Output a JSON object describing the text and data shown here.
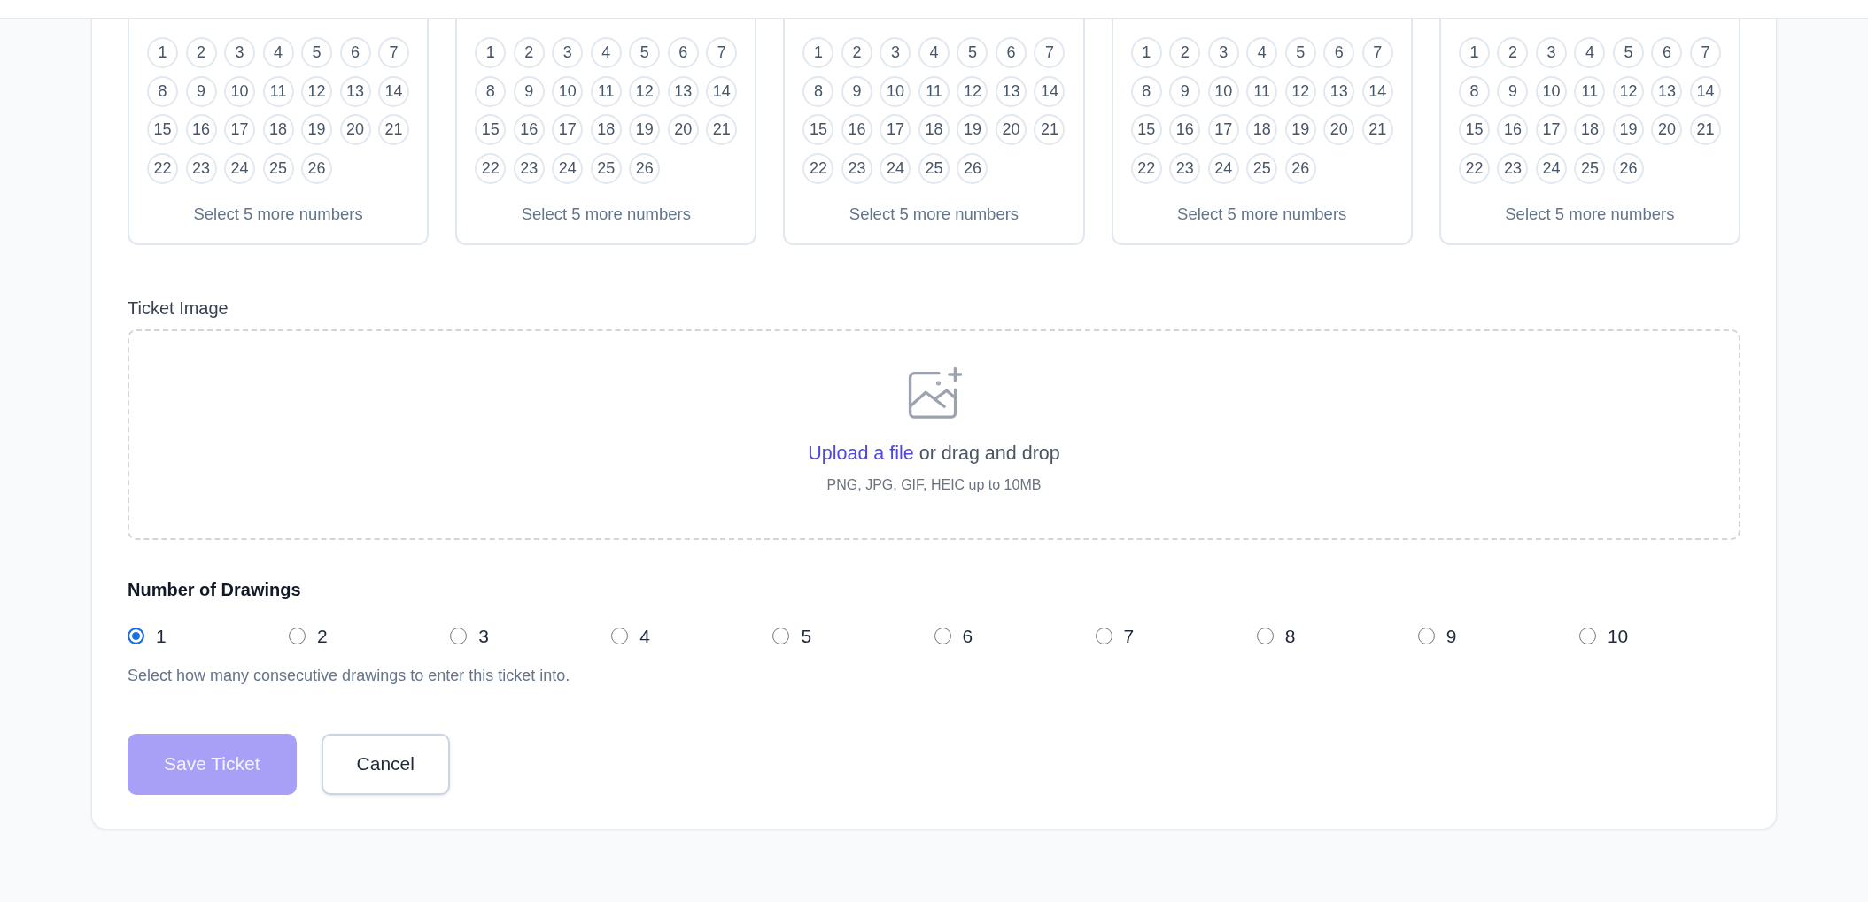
{
  "tickets": [
    {
      "numbers": [
        {
          "label": "1",
          "selected": false
        },
        {
          "label": "2",
          "selected": false
        },
        {
          "label": "3",
          "selected": false
        },
        {
          "label": "4",
          "selected": false
        },
        {
          "label": "5",
          "selected": false
        },
        {
          "label": "6",
          "selected": false
        },
        {
          "label": "7",
          "selected": false
        },
        {
          "label": "8",
          "selected": false
        },
        {
          "label": "9",
          "selected": false
        },
        {
          "label": "10",
          "selected": false
        },
        {
          "label": "11",
          "selected": false
        },
        {
          "label": "12",
          "selected": false
        },
        {
          "label": "13",
          "selected": false
        },
        {
          "label": "14",
          "selected": false
        },
        {
          "label": "15",
          "selected": false
        },
        {
          "label": "16",
          "selected": false
        },
        {
          "label": "17",
          "selected": false
        },
        {
          "label": "18",
          "selected": false
        },
        {
          "label": "19",
          "selected": false
        },
        {
          "label": "20",
          "selected": false
        },
        {
          "label": "21",
          "selected": false
        },
        {
          "label": "22",
          "selected": false
        },
        {
          "label": "23",
          "selected": false
        },
        {
          "label": "24",
          "selected": false
        },
        {
          "label": "25",
          "selected": false
        },
        {
          "label": "26",
          "selected": false
        }
      ],
      "hint": "Select 5 more numbers"
    },
    {
      "numbers": [
        {
          "label": "1",
          "selected": false
        },
        {
          "label": "2",
          "selected": false
        },
        {
          "label": "3",
          "selected": false
        },
        {
          "label": "4",
          "selected": false
        },
        {
          "label": "5",
          "selected": false
        },
        {
          "label": "6",
          "selected": false
        },
        {
          "label": "7",
          "selected": false
        },
        {
          "label": "8",
          "selected": false
        },
        {
          "label": "9",
          "selected": false
        },
        {
          "label": "10",
          "selected": false
        },
        {
          "label": "11",
          "selected": false
        },
        {
          "label": "12",
          "selected": false
        },
        {
          "label": "13",
          "selected": false
        },
        {
          "label": "14",
          "selected": false
        },
        {
          "label": "15",
          "selected": false
        },
        {
          "label": "16",
          "selected": false
        },
        {
          "label": "17",
          "selected": false
        },
        {
          "label": "18",
          "selected": false
        },
        {
          "label": "19",
          "selected": false
        },
        {
          "label": "20",
          "selected": false
        },
        {
          "label": "21",
          "selected": false
        },
        {
          "label": "22",
          "selected": false
        },
        {
          "label": "23",
          "selected": false
        },
        {
          "label": "24",
          "selected": false
        },
        {
          "label": "25",
          "selected": false
        },
        {
          "label": "26",
          "selected": false
        }
      ],
      "hint": "Select 5 more numbers"
    },
    {
      "numbers": [
        {
          "label": "1",
          "selected": false
        },
        {
          "label": "2",
          "selected": false
        },
        {
          "label": "3",
          "selected": false
        },
        {
          "label": "4",
          "selected": false
        },
        {
          "label": "5",
          "selected": false
        },
        {
          "label": "6",
          "selected": false
        },
        {
          "label": "7",
          "selected": false
        },
        {
          "label": "8",
          "selected": false
        },
        {
          "label": "9",
          "selected": false
        },
        {
          "label": "10",
          "selected": false
        },
        {
          "label": "11",
          "selected": false
        },
        {
          "label": "12",
          "selected": false
        },
        {
          "label": "13",
          "selected": false
        },
        {
          "label": "14",
          "selected": false
        },
        {
          "label": "15",
          "selected": false
        },
        {
          "label": "16",
          "selected": false
        },
        {
          "label": "17",
          "selected": false
        },
        {
          "label": "18",
          "selected": false
        },
        {
          "label": "19",
          "selected": false
        },
        {
          "label": "20",
          "selected": false
        },
        {
          "label": "21",
          "selected": false
        },
        {
          "label": "22",
          "selected": false
        },
        {
          "label": "23",
          "selected": false
        },
        {
          "label": "24",
          "selected": false
        },
        {
          "label": "25",
          "selected": false
        },
        {
          "label": "26",
          "selected": false
        }
      ],
      "hint": "Select 5 more numbers"
    },
    {
      "numbers": [
        {
          "label": "1",
          "selected": false
        },
        {
          "label": "2",
          "selected": false
        },
        {
          "label": "3",
          "selected": false
        },
        {
          "label": "4",
          "selected": false
        },
        {
          "label": "5",
          "selected": false
        },
        {
          "label": "6",
          "selected": false
        },
        {
          "label": "7",
          "selected": false
        },
        {
          "label": "8",
          "selected": false
        },
        {
          "label": "9",
          "selected": false
        },
        {
          "label": "10",
          "selected": false
        },
        {
          "label": "11",
          "selected": false
        },
        {
          "label": "12",
          "selected": false
        },
        {
          "label": "13",
          "selected": false
        },
        {
          "label": "14",
          "selected": false
        },
        {
          "label": "15",
          "selected": false
        },
        {
          "label": "16",
          "selected": false
        },
        {
          "label": "17",
          "selected": false
        },
        {
          "label": "18",
          "selected": false
        },
        {
          "label": "19",
          "selected": false
        },
        {
          "label": "20",
          "selected": false
        },
        {
          "label": "21",
          "selected": false
        },
        {
          "label": "22",
          "selected": false
        },
        {
          "label": "23",
          "selected": false
        },
        {
          "label": "24",
          "selected": false
        },
        {
          "label": "25",
          "selected": false
        },
        {
          "label": "26",
          "selected": false
        }
      ],
      "hint": "Select 5 more numbers"
    },
    {
      "numbers": [
        {
          "label": "1",
          "selected": false
        },
        {
          "label": "2",
          "selected": false
        },
        {
          "label": "3",
          "selected": false
        },
        {
          "label": "4",
          "selected": false
        },
        {
          "label": "5",
          "selected": false
        },
        {
          "label": "6",
          "selected": false
        },
        {
          "label": "7",
          "selected": false
        },
        {
          "label": "8",
          "selected": false
        },
        {
          "label": "9",
          "selected": false
        },
        {
          "label": "10",
          "selected": false
        },
        {
          "label": "11",
          "selected": false
        },
        {
          "label": "12",
          "selected": false
        },
        {
          "label": "13",
          "selected": false
        },
        {
          "label": "14",
          "selected": false
        },
        {
          "label": "15",
          "selected": false
        },
        {
          "label": "16",
          "selected": false
        },
        {
          "label": "17",
          "selected": false
        },
        {
          "label": "18",
          "selected": false
        },
        {
          "label": "19",
          "selected": false
        },
        {
          "label": "20",
          "selected": false
        },
        {
          "label": "21",
          "selected": false
        },
        {
          "label": "22",
          "selected": false
        },
        {
          "label": "23",
          "selected": false
        },
        {
          "label": "24",
          "selected": false
        },
        {
          "label": "25",
          "selected": false
        },
        {
          "label": "26",
          "selected": false
        }
      ],
      "hint": "Select 5 more numbers"
    }
  ],
  "ticket_image": {
    "label": "Ticket Image",
    "upload_link": "Upload a file",
    "upload_text": "or drag and drop",
    "hint": "PNG, JPG, GIF, HEIC up to 10MB"
  },
  "drawings": {
    "label": "Number of Drawings",
    "options": [
      {
        "label": "1",
        "selected": true
      },
      {
        "label": "2",
        "selected": false
      },
      {
        "label": "3",
        "selected": false
      },
      {
        "label": "4",
        "selected": false
      },
      {
        "label": "5",
        "selected": false
      },
      {
        "label": "6",
        "selected": false
      },
      {
        "label": "7",
        "selected": false
      },
      {
        "label": "8",
        "selected": false
      },
      {
        "label": "9",
        "selected": false
      },
      {
        "label": "10",
        "selected": false
      }
    ],
    "help": "Select how many consecutive drawings to enter this ticket into."
  },
  "buttons": [
    {
      "label": "Save Ticket",
      "kind": "primary",
      "disabled": true
    },
    {
      "label": "Cancel",
      "kind": "secondary",
      "disabled": false
    }
  ]
}
